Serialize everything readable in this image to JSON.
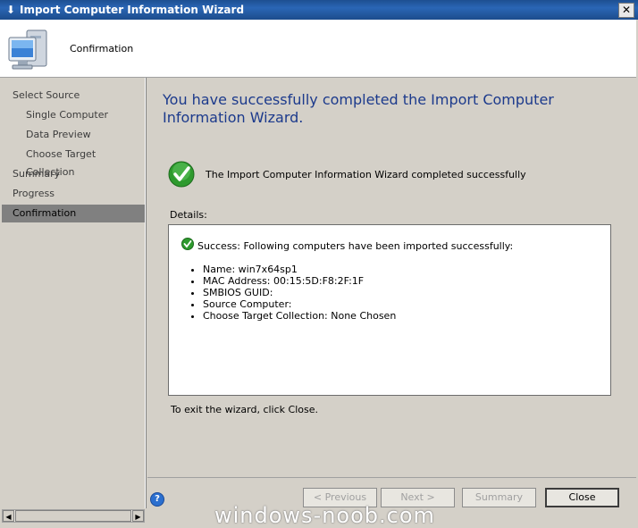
{
  "window": {
    "title": "Import Computer Information Wizard",
    "close_glyph": "✕",
    "app_icon": "download-arrow-icon"
  },
  "header": {
    "page_title": "Confirmation",
    "icon": "computer-monitor-icon"
  },
  "nav": {
    "items": [
      {
        "label": "Select Source",
        "level": 1,
        "active": false
      },
      {
        "label": "Single Computer",
        "level": 2,
        "active": false
      },
      {
        "label": "Data Preview",
        "level": 2,
        "active": false
      },
      {
        "label": "Choose Target Collection",
        "level": 2,
        "active": false
      },
      {
        "label": "Summary",
        "level": 1,
        "active": false
      },
      {
        "label": "Progress",
        "level": 1,
        "active": false
      },
      {
        "label": "Confirmation",
        "level": 1,
        "active": true
      }
    ]
  },
  "main": {
    "title": "You have successfully completed the Import Computer Information Wizard.",
    "status_text": "The Import Computer Information Wizard completed successfully",
    "details_label": "Details:",
    "details": {
      "summary": "Success: Following computers have been imported successfully:",
      "items": [
        "Name: win7x64sp1",
        "MAC Address: 00:15:5D:F8:2F:1F",
        "SMBIOS GUID:",
        "Source Computer:",
        "Choose Target Collection: None Chosen"
      ]
    },
    "exit_text": "To exit the wizard, click Close."
  },
  "footer": {
    "help_glyph": "?",
    "buttons": {
      "previous": "< Previous",
      "next": "Next >",
      "summary": "Summary",
      "close": "Close"
    }
  },
  "watermark": "windows-noob.com",
  "colors": {
    "title_blue": "#1c3a8c",
    "titlebar": "#1d4f91",
    "success_green": "#2e9a2e"
  }
}
